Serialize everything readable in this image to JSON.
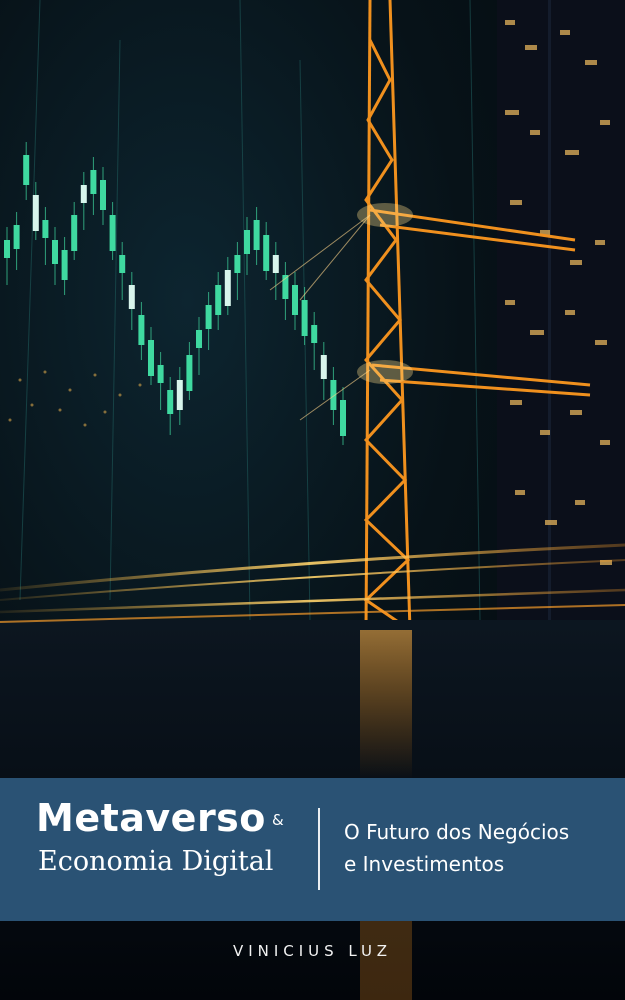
{
  "cover": {
    "title": "Metaverso",
    "ampersand": "&",
    "subtitle": "Economia Digital",
    "tagline_line1": "O Futuro dos Negócios",
    "tagline_line2": "e Investimentos",
    "author": "VINICIUS LUZ"
  },
  "colors": {
    "band": "#2a5274",
    "candle_green": "#3fd9a0",
    "crane_orange": "#f0901e"
  }
}
